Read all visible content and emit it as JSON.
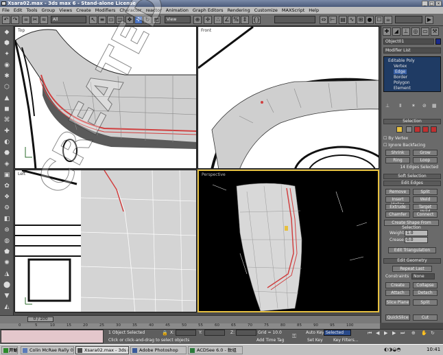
{
  "window": {
    "title": "Xsara02.max - 3ds max 6 - Stand-alone License"
  },
  "menu": [
    "File",
    "Edit",
    "Tools",
    "Group",
    "Views",
    "Create",
    "Modifiers",
    "Character",
    "reactor",
    "Animation",
    "Graph Editors",
    "Rendering",
    "Customize",
    "MAXScript",
    "Help"
  ],
  "toolbar": {
    "selection_filter": "All",
    "ref_coord": "View"
  },
  "viewports": {
    "top": "Top",
    "front": "Front",
    "left": "Left",
    "persp": "Perspective"
  },
  "command_panel": {
    "object_name": "Object01",
    "modifier_list": "Modifier List",
    "stack": [
      "Editable Poly",
      "Vertex",
      "Edge",
      "Border",
      "Polygon",
      "Element"
    ],
    "selection": {
      "title": "Selection",
      "by_vertex": "By Vertex",
      "ignore_backfacing": "Ignore Backfacing",
      "shrink": "Shrink",
      "grow": "Grow",
      "ring": "Ring",
      "loop": "Loop",
      "status": "14 Edges Selected"
    },
    "soft_selection": "Soft Selection",
    "edit_edges": {
      "title": "Edit Edges",
      "remove": "Remove",
      "split": "Split",
      "insert_vertex": "Insert Vertex",
      "weld": "Weld",
      "extrude": "Extrude",
      "target_weld": "Target Weld",
      "chamfer": "Chamfer",
      "connect": "Connect",
      "create_shape": "Create Shape From Selection",
      "weight_label": "Weight:",
      "weight": "1.0",
      "crease_label": "Crease:",
      "crease": "0.0",
      "edit_tri": "Edit Triangulation"
    },
    "edit_geometry": {
      "title": "Edit Geometry",
      "repeat_last": "Repeat Last",
      "constraints_label": "Constraints",
      "constraints": "None",
      "create": "Create",
      "collapse": "Collapse",
      "attach": "Attach",
      "detach": "Detach",
      "slice_plane": "Slice Plane",
      "split": "Split",
      "quickslice": "QuickSlice",
      "cut": "Cut"
    }
  },
  "timeline": {
    "slider": "0 / 100",
    "ticks": [
      "0",
      "5",
      "10",
      "15",
      "20",
      "25",
      "30",
      "35",
      "40",
      "45",
      "50",
      "55",
      "60",
      "65",
      "70",
      "75",
      "80",
      "85",
      "90",
      "95",
      "100"
    ]
  },
  "status": {
    "selected": "1 Object Selected",
    "hint": "Click or click-and-drag to select objects",
    "x_label": "X:",
    "y_label": "Y:",
    "z_label": "Z:",
    "grid": "Grid = 10.0",
    "add_time_tag": "Add Time Tag",
    "auto_key": "Auto Key",
    "key_mode": "Selected",
    "set_key": "Set Key",
    "key_filters": "Key Filters..."
  },
  "taskbar": {
    "start": "开始",
    "items": [
      "Colin McRae Rally 04",
      "Xsara02.max - 3ds max ...",
      "Adobe Photoshop",
      "ACDSee 6.0 - 数组"
    ],
    "clock": "10:41"
  },
  "watermark": "CREATED BY SHANSHI",
  "colors": {
    "select_edge": "#d04040",
    "vp_border_active": "#e6c040",
    "stack_bg": "#1f3b64"
  }
}
